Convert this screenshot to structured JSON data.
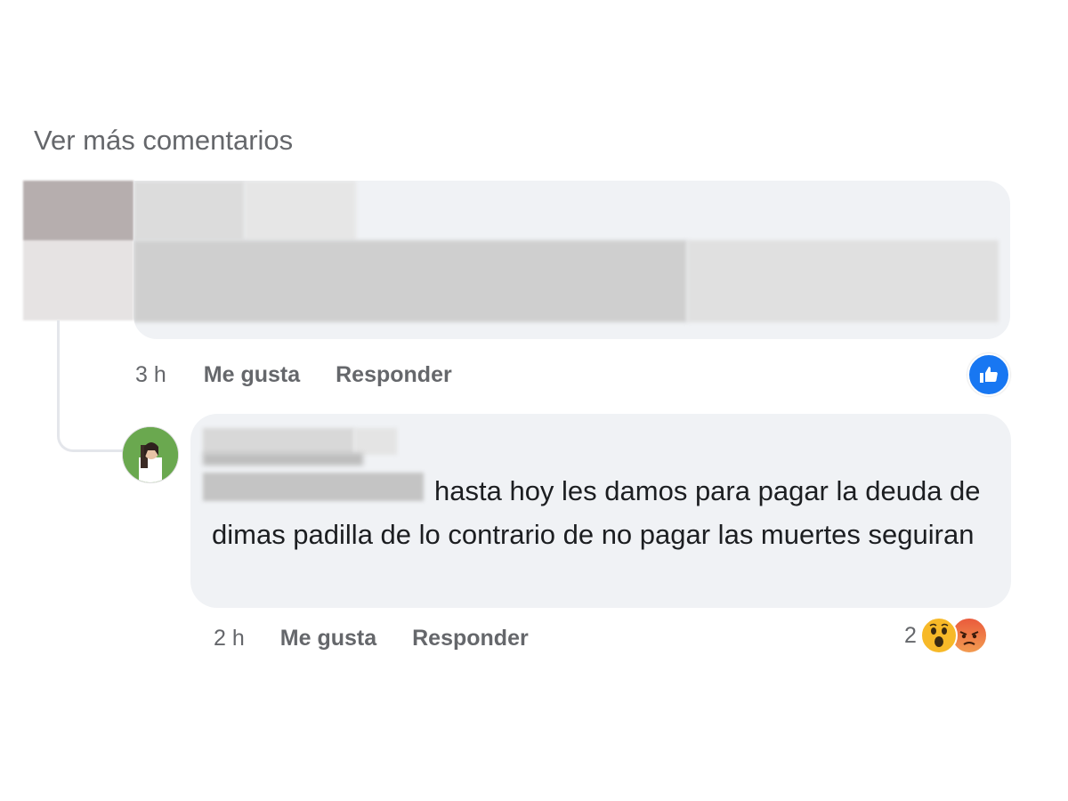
{
  "comments_section": {
    "see_more_label": "Ver más comentarios"
  },
  "comment_1": {
    "time": "3 h",
    "like_label": "Me gusta",
    "reply_label": "Responder",
    "reaction_icon": "like-icon",
    "reaction_color": "#1877f2"
  },
  "comment_2": {
    "text": "hasta hoy les damos para pagar la deuda de dimas padilla de lo contrario de no pagar las muertes seguiran",
    "time": "2 h",
    "like_label": "Me gusta",
    "reply_label": "Responder",
    "reaction_count": "2",
    "reaction_icons": [
      "wow-icon",
      "angry-icon"
    ]
  },
  "colors": {
    "bubble_bg": "#f0f2f5",
    "secondary_text": "#65676b",
    "like_blue": "#1877f2"
  }
}
